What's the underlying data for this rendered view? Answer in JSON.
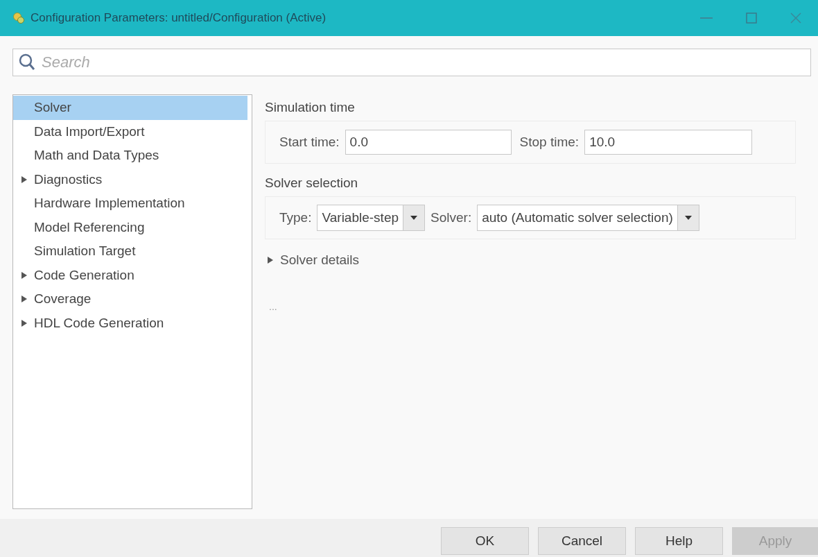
{
  "window": {
    "title": "Configuration Parameters: untitled/Configuration (Active)"
  },
  "search": {
    "placeholder": "Search"
  },
  "tree": [
    {
      "label": "Solver",
      "kind": "leaf",
      "selected": true
    },
    {
      "label": "Data Import/Export",
      "kind": "leaf",
      "selected": false
    },
    {
      "label": "Math and Data Types",
      "kind": "leaf",
      "selected": false
    },
    {
      "label": "Diagnostics",
      "kind": "branch",
      "selected": false
    },
    {
      "label": "Hardware Implementation",
      "kind": "leaf",
      "selected": false
    },
    {
      "label": "Model Referencing",
      "kind": "leaf",
      "selected": false
    },
    {
      "label": "Simulation Target",
      "kind": "leaf",
      "selected": false
    },
    {
      "label": "Code Generation",
      "kind": "branch",
      "selected": false
    },
    {
      "label": "Coverage",
      "kind": "branch",
      "selected": false
    },
    {
      "label": "HDL Code Generation",
      "kind": "branch",
      "selected": false
    }
  ],
  "simulation_time": {
    "title": "Simulation time",
    "start_label": "Start time:",
    "start_value": "0.0",
    "stop_label": "Stop time:",
    "stop_value": "10.0"
  },
  "solver_selection": {
    "title": "Solver selection",
    "type_label": "Type:",
    "type_value": "Variable-step",
    "solver_label": "Solver:",
    "solver_value": "auto (Automatic solver selection)"
  },
  "solver_details": {
    "label": "Solver details",
    "expanded": false
  },
  "ellipsis": "...",
  "buttons": [
    {
      "label": "OK",
      "disabled": false
    },
    {
      "label": "Cancel",
      "disabled": false
    },
    {
      "label": "Help",
      "disabled": false
    },
    {
      "label": "Apply",
      "disabled": true
    }
  ]
}
